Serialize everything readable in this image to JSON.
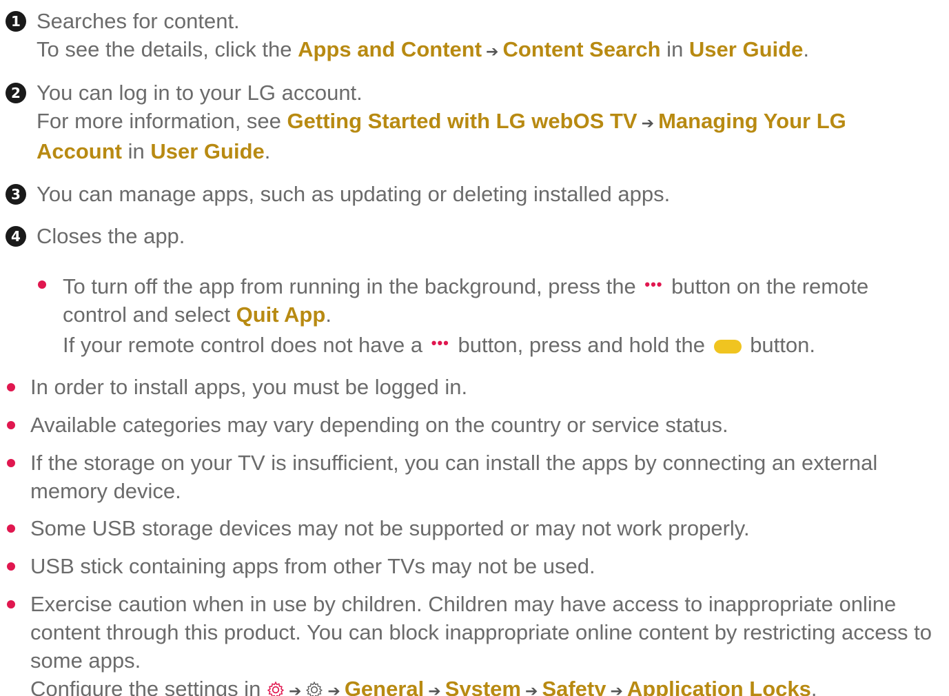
{
  "items": [
    {
      "badge": "1",
      "line1": "Searches for content.",
      "l2_pre": "To see the details, click the ",
      "l2_link1": "Apps and Content",
      "l2_link2": "Content Search",
      "l2_in": " in ",
      "l2_link3": "User Guide",
      "l2_end": "."
    },
    {
      "badge": "2",
      "line1": "You can log in to your LG account.",
      "l2_pre": "For more information, see ",
      "l2_link1": "Getting Started with LG webOS TV",
      "l2_link2a": "Managing Your LG",
      "l2_link2b": "Account",
      "l2_in": " in ",
      "l2_link3": "User Guide",
      "l2_end": "."
    },
    {
      "badge": "3",
      "line1": "You can manage apps, such as updating or deleting installed apps."
    },
    {
      "badge": "4",
      "line1": "Closes the app."
    }
  ],
  "sub_bullet": {
    "t1": "To turn off the app from running in the background, press the ",
    "t2": " button on the remote control and select ",
    "link": "Quit App",
    "t3": ".",
    "t4": "If your remote control does not have a ",
    "t5": " button, press and hold the ",
    "t6": " button.",
    "dots_glyph": "•••"
  },
  "notes": [
    "In order to install apps, you must be logged in.",
    "Available categories may vary depending on the country or service status.",
    "If the storage on your TV is insufficient, you can install the apps by connecting an external memory device.",
    "Some USB storage devices may not be supported or may not work properly.",
    "USB stick containing apps from other TVs may not be used.",
    "Exercise caution when in use by children. Children may have access to inappropriate online content through this product. You can block inappropriate online content by restricting access to some apps."
  ],
  "config": {
    "pre": "Configure the settings in ",
    "link1": "General",
    "link2": "System",
    "link3": "Safety",
    "link4": "Application Locks",
    "end": "."
  },
  "colors": {
    "link": "#b88a12",
    "bullet": "#e0174f",
    "yellow_button": "#f0c420",
    "text": "#6b6b6b"
  }
}
